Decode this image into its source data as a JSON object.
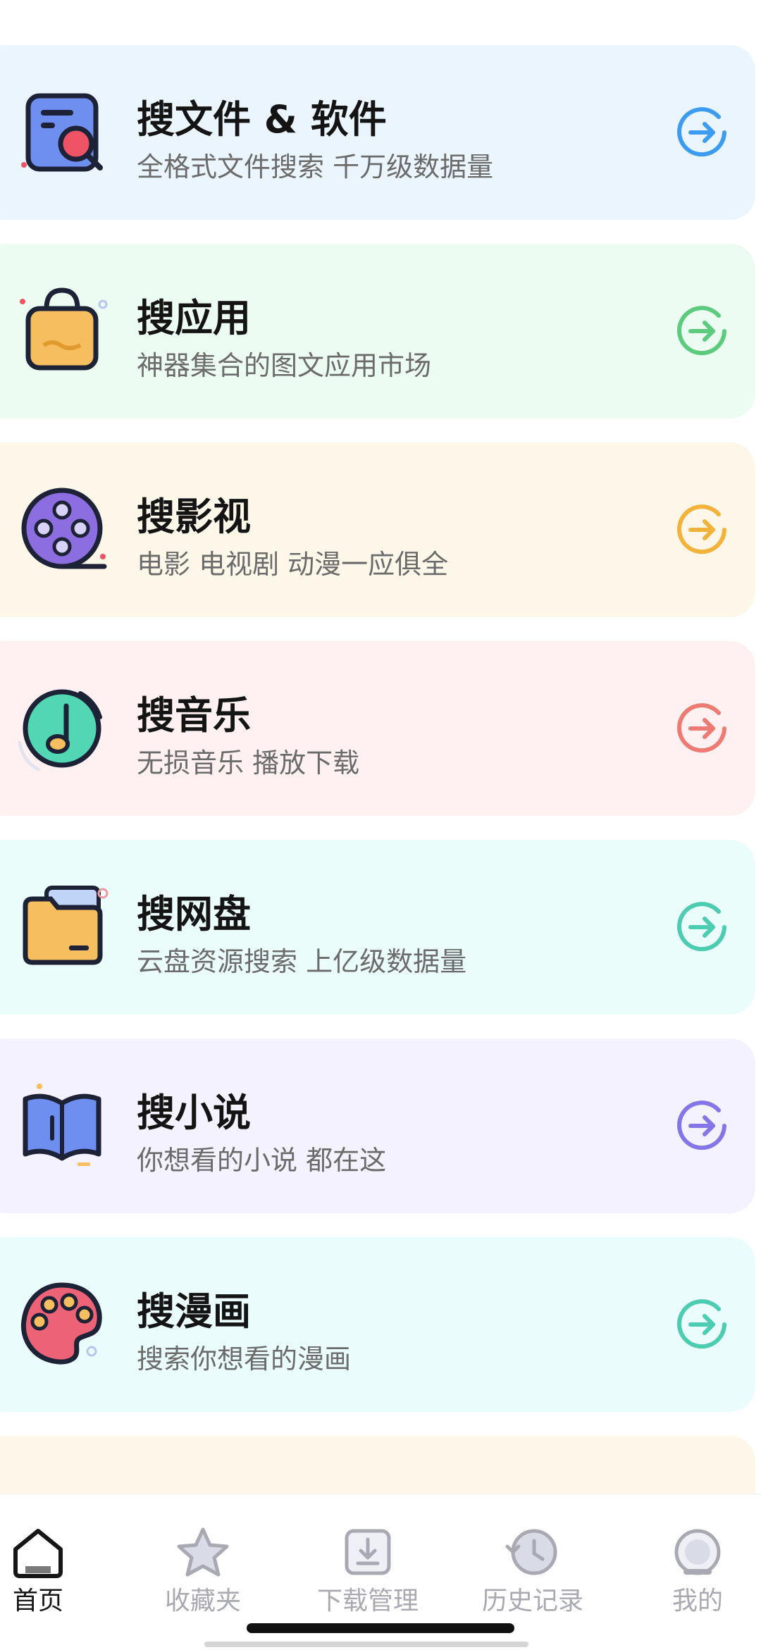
{
  "cards": [
    {
      "title": "搜文件 & 软件",
      "subtitle": "全格式文件搜索 千万级数据量",
      "bg": "#EAF5FE",
      "accent": "#3E9CF0",
      "icon": "file-search-icon"
    },
    {
      "title": "搜应用",
      "subtitle": "神器集合的图文应用市场",
      "bg": "#EDFCF2",
      "accent": "#5DCB7E",
      "icon": "shopping-bag-icon"
    },
    {
      "title": "搜影视",
      "subtitle": "电影 电视剧 动漫一应俱全",
      "bg": "#FDF7EA",
      "accent": "#F3B23A",
      "icon": "film-reel-icon"
    },
    {
      "title": "搜音乐",
      "subtitle": "无损音乐 播放下载",
      "bg": "#FFF1F1",
      "accent": "#EE7A74",
      "icon": "music-note-icon"
    },
    {
      "title": "搜网盘",
      "subtitle": "云盘资源搜索 上亿级数据量",
      "bg": "#EBFDFA",
      "accent": "#4CCCB0",
      "icon": "folder-icon"
    },
    {
      "title": "搜小说",
      "subtitle": "你想看的小说 都在这",
      "bg": "#F3F2FE",
      "accent": "#8475E8",
      "icon": "book-icon"
    },
    {
      "title": "搜漫画",
      "subtitle": "搜索你想看的漫画",
      "bg": "#EBFCFC",
      "accent": "#4CCCB0",
      "icon": "palette-icon"
    },
    {
      "title": "",
      "subtitle": "",
      "bg": "#FDF7EA",
      "accent": "#F3B23A",
      "icon": "partial-card-icon"
    }
  ],
  "tabs": [
    {
      "label": "首页",
      "icon": "home-icon",
      "active": true
    },
    {
      "label": "收藏夹",
      "icon": "star-icon",
      "active": false
    },
    {
      "label": "下载管理",
      "icon": "download-icon",
      "active": false
    },
    {
      "label": "历史记录",
      "icon": "history-icon",
      "active": false
    },
    {
      "label": "我的",
      "icon": "profile-icon",
      "active": false
    }
  ]
}
